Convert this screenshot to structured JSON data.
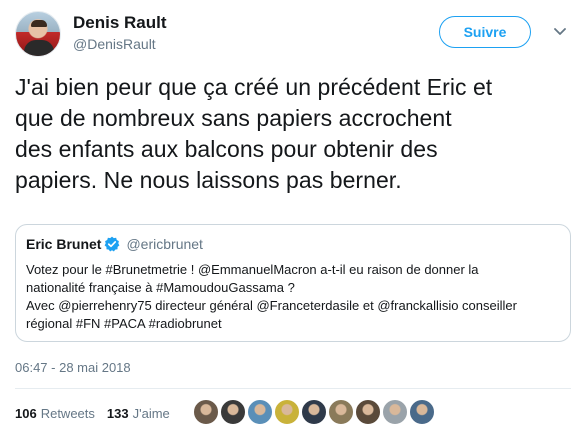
{
  "author": {
    "name": "Denis Rault",
    "handle": "@DenisRault"
  },
  "follow_button": {
    "label": "Suivre"
  },
  "tweet": {
    "lines": [
      "J'ai bien peur que ça créé un précédent Eric et",
      "que de nombreux sans papiers accrochent",
      "des enfants aux balcons pour obtenir des",
      "papiers. Ne nous laissons pas berner."
    ]
  },
  "quoted": {
    "name": "Eric Brunet",
    "handle": "@ericbrunet",
    "lines": [
      "Votez pour le #Brunetmetrie ! @EmmanuelMacron a-t-il eu raison de donner la",
      "nationalité française à #MamoudouGassama ?",
      "Avec @pierrehenry75 directeur général @Franceterdasile et @franckallisio conseiller",
      "régional #FN #PACA #radiobrunet"
    ]
  },
  "timestamp": "06:47 - 28 mai 2018",
  "stats": {
    "retweets_count": "106",
    "retweets_label": "Retweets",
    "likes_count": "133",
    "likes_label": "J'aime"
  },
  "liker_avatars": [
    {
      "color": "#6b5a4a"
    },
    {
      "color": "#3a3a3a"
    },
    {
      "color": "#5a8fb8"
    },
    {
      "color": "#c9b23a"
    },
    {
      "color": "#2f3a4a"
    },
    {
      "color": "#8a7a5a"
    },
    {
      "color": "#5a4a3a"
    },
    {
      "color": "#9aa3aa"
    },
    {
      "color": "#4a6a8a"
    }
  ],
  "colors": {
    "accent": "#1da1f2",
    "text": "#14171a",
    "muted": "#657786",
    "border": "#ccd6dd"
  }
}
